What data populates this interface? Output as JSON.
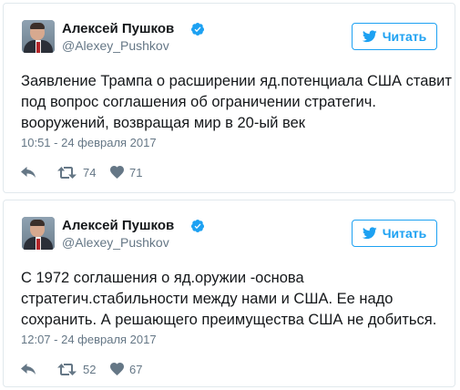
{
  "colors": {
    "accent": "#1da1f2",
    "text": "#14171a",
    "muted": "#657786",
    "border": "#e1e8ed"
  },
  "tweets": [
    {
      "author_name": "Алексей Пушков",
      "handle": "@Alexey_Pushkov",
      "follow_label": "Читать",
      "text_lines": [
        "Заявление Трампа о расширении яд.потенциала США ставит",
        "под вопрос соглашения об ограничении стратегич.",
        "вооружений, возвращая мир в 20-ый век"
      ],
      "timestamp": "10:51 - 24 февраля 2017",
      "retweets": "74",
      "likes": "71",
      "icons": [
        "verified-icon",
        "twitter-bird-icon",
        "reply-icon",
        "retweet-icon",
        "heart-icon"
      ]
    },
    {
      "author_name": "Алексей Пушков",
      "handle": "@Alexey_Pushkov",
      "follow_label": "Читать",
      "text_lines": [
        "С 1972 соглашения о яд.оружии -основа",
        "стратегич.стабильности между нами и США. Ее надо",
        "сохранить. А решающего преимущества США не добиться."
      ],
      "timestamp": "12:07 - 24 февраля 2017",
      "retweets": "52",
      "likes": "67",
      "icons": [
        "verified-icon",
        "twitter-bird-icon",
        "reply-icon",
        "retweet-icon",
        "heart-icon"
      ]
    }
  ]
}
